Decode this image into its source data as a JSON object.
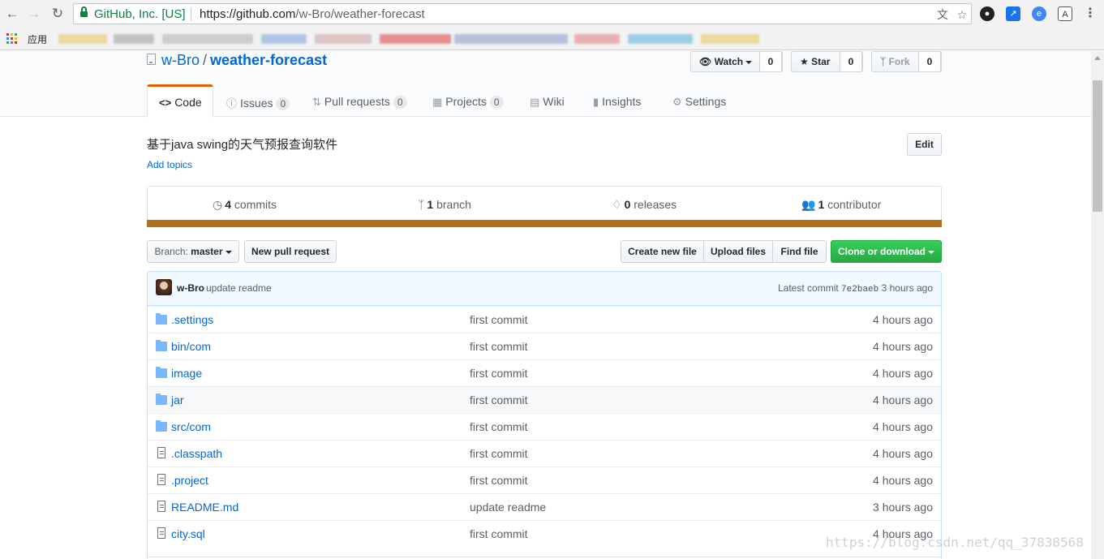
{
  "browser": {
    "back_icon": "arrow-left-icon",
    "forward_icon": "arrow-right-icon",
    "reload_icon": "reload-icon",
    "org_name": "GitHub, Inc. [US]",
    "url_prefix": "https://github.com",
    "url_path": "/w-Bro/weather-forecast",
    "apps_label": "应用",
    "menu_icon": "vertical-dots-icon"
  },
  "repo": {
    "owner": "w-Bro",
    "separator": "/",
    "name": "weather-forecast",
    "watch": {
      "label": "Watch",
      "count": "0"
    },
    "star": {
      "label": "Star",
      "count": "0"
    },
    "fork": {
      "label": "Fork",
      "count": "0"
    }
  },
  "tabs": [
    {
      "label": "Code"
    },
    {
      "label": "Issues",
      "count": "0"
    },
    {
      "label": "Pull requests",
      "count": "0"
    },
    {
      "label": "Projects",
      "count": "0"
    },
    {
      "label": "Wiki"
    },
    {
      "label": "Insights"
    },
    {
      "label": "Settings"
    }
  ],
  "about": {
    "description": "基于java swing的天气预报查询软件",
    "add_topics": "Add topics",
    "edit": "Edit"
  },
  "summary": {
    "commits_n": "4",
    "commits": "commits",
    "branch_n": "1",
    "branch": "branch",
    "releases_n": "0",
    "releases": "releases",
    "contributors_n": "1",
    "contributors": "contributor",
    "language_color": "#b07219"
  },
  "toolbar": {
    "branch_prefix": "Branch:",
    "branch_name": "master",
    "new_pr": "New pull request",
    "create_file": "Create new file",
    "upload_files": "Upload files",
    "find_file": "Find file",
    "clone": "Clone or download"
  },
  "latest_commit": {
    "author": "w-Bro",
    "message": "update readme",
    "label": "Latest commit",
    "sha": "7e2baeb",
    "age": "3 hours ago"
  },
  "files": [
    {
      "name": ".settings",
      "type": "dir",
      "message": "first commit",
      "age": "4 hours ago"
    },
    {
      "name": "bin/com",
      "type": "dir",
      "message": "first commit",
      "age": "4 hours ago"
    },
    {
      "name": "image",
      "type": "dir",
      "message": "first commit",
      "age": "4 hours ago"
    },
    {
      "name": "jar",
      "type": "dir",
      "message": "first commit",
      "age": "4 hours ago"
    },
    {
      "name": "src/com",
      "type": "dir",
      "message": "first commit",
      "age": "4 hours ago"
    },
    {
      "name": ".classpath",
      "type": "file",
      "message": "first commit",
      "age": "4 hours ago"
    },
    {
      "name": ".project",
      "type": "file",
      "message": "first commit",
      "age": "4 hours ago"
    },
    {
      "name": "README.md",
      "type": "file",
      "message": "update readme",
      "age": "3 hours ago"
    },
    {
      "name": "city.sql",
      "type": "file",
      "message": "first commit",
      "age": "4 hours ago"
    }
  ],
  "watermark": "https://blog.csdn.net/qq_37838568"
}
